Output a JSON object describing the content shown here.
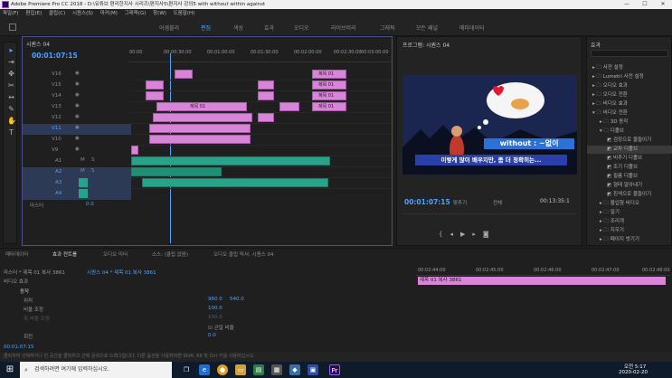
{
  "titlebar": {
    "title": "Adobe Premiere Pro CC 2018 - D:\\유튜브 편리한지사 시리즈\\편지사5\\편지사 강의5 with without within against"
  },
  "menu": [
    "파일(F)",
    "편집(E)",
    "클립(C)",
    "시퀀스(S)",
    "마커(M)",
    "그래픽(G)",
    "창(W)",
    "도움말(H)"
  ],
  "workspaces": [
    "어셈블리",
    "편집",
    "색상",
    "효과",
    "오디오",
    "라이브러리",
    "그래픽",
    "모든 패널",
    "메타데이터"
  ],
  "active_workspace": "편집",
  "timeline": {
    "tab": "시퀀스 04",
    "timecode": "00:01:07:15",
    "ruler": [
      "00:00",
      "00:00:30:00",
      "00:01:00:00",
      "00:01:30:00",
      "00:02:00:00",
      "00:02:30:00",
      "00:03:00:00"
    ],
    "video_tracks": [
      "V16",
      "V15",
      "V14",
      "V13",
      "V12",
      "V11",
      "V10",
      "V9"
    ],
    "audio_tracks": [
      "A1",
      "A2",
      "A3",
      "A4"
    ],
    "master": "마스터",
    "master_val": "0.0",
    "clip_label": "제목 01"
  },
  "program": {
    "tab": "프로그램: 시퀀스 04",
    "overlay_word": "without : ~없이",
    "subtitle": "이렇게 많이 배우지만, 좀 더 정확히는...",
    "timecode": "00:01:07:15",
    "fit": "맞추기",
    "quality": "전체",
    "duration": "00:13:35:1"
  },
  "effects": {
    "tab": "효과",
    "items": [
      "사전 설정",
      "Lumetri 사전 설정",
      "오디오 효과",
      "오디오 전환",
      "비디오 효과",
      "비디오 전환",
      "3D 동작",
      "디졸브",
      "검정으로 물들이기",
      "교차 디졸브",
      "비추기 디졸브",
      "조기 디졸브",
      "필름 디졸브",
      "형태 알아내기",
      "흰색으로 물들이기",
      "몰입형 비디오",
      "밀기",
      "조리개",
      "지우기",
      "페이지 벗기기"
    ]
  },
  "bottom": {
    "tabs": [
      "메타데이터",
      "효과 컨트롤",
      "오디오 미터",
      "소스: (클립 없음)",
      "오디오 클립 믹서: 시퀀스 04"
    ],
    "active_tab": "효과 컨트롤",
    "source_label": "마스터 * 제목 01 복사 3861",
    "seq_label": "시퀀스 04 * 제목 01 복사 3861",
    "section": "비디오 효과",
    "fx": "동작",
    "props": [
      {
        "name": "위치",
        "value": "960.0",
        "value2": "540.0"
      },
      {
        "name": "비율 조정",
        "value": "100.0"
      },
      {
        "name": "폭 비율 조정",
        "value": "100.0"
      },
      {
        "name": "",
        "value": "균일 비율"
      },
      {
        "name": "회전",
        "value": "0.0"
      }
    ],
    "timecode": "00:01:07:15",
    "ruler": [
      "00:02:44:00",
      "00:02:45:00",
      "00:02:46:00",
      "00:02:47:00",
      "00:02:48:00"
    ],
    "clip_name": "제목 01 복사 3861"
  },
  "status": "클릭하여 선택하거나 빈 공간을 클릭하고 선택 윤곽으로 드래그합니다. 다른 옵션을 사용하려면 Shift, Alt 및 Ctrl 키를 사용하십시오.",
  "taskbar": {
    "search": "검색하려면 여기에 입력하십시오.",
    "time": "오전 5:17",
    "date": "2020-02-20"
  }
}
